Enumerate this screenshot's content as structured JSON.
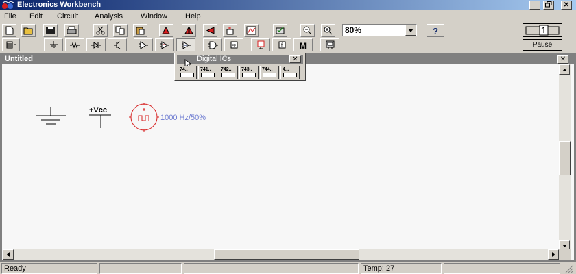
{
  "window": {
    "title": "Electronics Workbench"
  },
  "menu": [
    "File",
    "Edit",
    "Circuit",
    "Analysis",
    "Window",
    "Help"
  ],
  "toolbar": {
    "zoom_value": "80%",
    "pause_label": "Pause",
    "main_tools": [
      "new",
      "open",
      "save",
      "print",
      "cut",
      "copy",
      "paste",
      "rotate",
      "flip-horizontal",
      "flip-vertical",
      "subcircuit",
      "graph",
      "component-properties",
      "zoom-out",
      "zoom-in",
      "help"
    ],
    "parts_bins": [
      "favorites",
      "sources",
      "basic",
      "diodes",
      "transistors",
      "analog-ics",
      "mixed-ics",
      "digital-ics",
      "logic-gates",
      "digital",
      "indicators",
      "controls",
      "miscellaneous",
      "instruments"
    ]
  },
  "document": {
    "title": "Untitled"
  },
  "palette": {
    "title": "Digital ICs",
    "buttons": [
      "74..",
      "741..",
      "742..",
      "743..",
      "744..",
      "4..."
    ]
  },
  "components": {
    "vcc_label": "+Vcc",
    "clock_label": "1000 Hz/50%"
  },
  "status": {
    "message": "Ready",
    "temp": "Temp:  27"
  },
  "colors": {
    "titlebar": "#0a246a",
    "component": "#d71f1f",
    "clock_text": "#6d7bd1"
  }
}
